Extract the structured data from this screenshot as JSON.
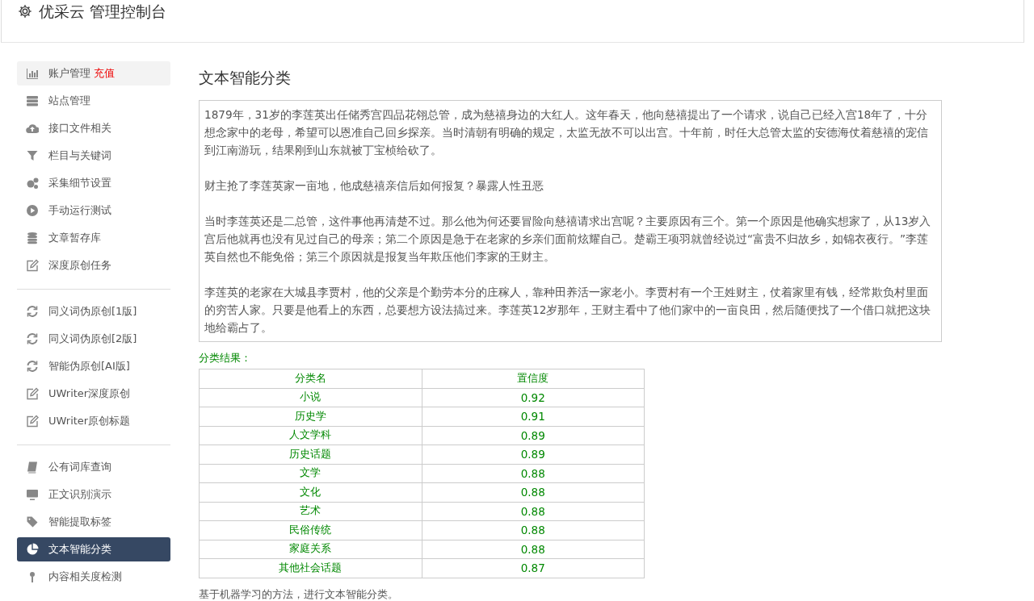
{
  "header": {
    "title": "优采云 管理控制台"
  },
  "sidebar": {
    "groups": [
      {
        "items": [
          {
            "label": "账户管理",
            "badge": "充值",
            "hovered": true,
            "selected": false
          },
          {
            "label": "站点管理",
            "hovered": false,
            "selected": false
          },
          {
            "label": "接口文件相关",
            "hovered": false,
            "selected": false
          },
          {
            "label": "栏目与关键词",
            "hovered": false,
            "selected": false
          },
          {
            "label": "采集细节设置",
            "hovered": false,
            "selected": false
          },
          {
            "label": "手动运行测试",
            "hovered": false,
            "selected": false
          },
          {
            "label": "文章暂存库",
            "hovered": false,
            "selected": false
          },
          {
            "label": "深度原创任务",
            "hovered": false,
            "selected": false
          }
        ]
      },
      {
        "items": [
          {
            "label": "同义词伪原创[1版]",
            "hovered": false,
            "selected": false
          },
          {
            "label": "同义词伪原创[2版]",
            "hovered": false,
            "selected": false
          },
          {
            "label": "智能伪原创[AI版]",
            "hovered": false,
            "selected": false
          },
          {
            "label": "UWriter深度原创",
            "hovered": false,
            "selected": false
          },
          {
            "label": "UWriter原创标题",
            "hovered": false,
            "selected": false
          }
        ]
      },
      {
        "items": [
          {
            "label": "公有词库查询",
            "hovered": false,
            "selected": false
          },
          {
            "label": "正文识别演示",
            "hovered": false,
            "selected": false
          },
          {
            "label": "智能提取标签",
            "hovered": false,
            "selected": false
          },
          {
            "label": "文本智能分类",
            "hovered": false,
            "selected": true
          },
          {
            "label": "内容相关度检测",
            "hovered": false,
            "selected": false
          }
        ]
      }
    ]
  },
  "main": {
    "title": "文本智能分类",
    "input": {
      "paragraphs": [
        "1879年，31岁的李莲英出任储秀宫四品花翎总管，成为慈禧身边的大红人。这年春天，他向慈禧提出了一个请求，说自己已经入宫18年了，十分想念家中的老母，希望可以恩准自己回乡探亲。当时清朝有明确的规定，太监无故不可以出宫。十年前，时任大总管太监的安德海仗着慈禧的宠信到江南游玩，结果刚到山东就被丁宝桢给砍了。",
        "财主抢了李莲英家一亩地，他成慈禧亲信后如何报复？暴露人性丑恶",
        "当时李莲英还是二总管，这件事他再清楚不过。那么他为何还要冒险向慈禧请求出宫呢？主要原因有三个。第一个原因是他确实想家了，从13岁入宫后他就再也没有见过自己的母亲；第二个原因是急于在老家的乡亲们面前炫耀自己。楚霸王项羽就曾经说过“富贵不归故乡，如锦衣夜行。”李莲英自然也不能免俗；第三个原因就是报复当年欺压他们李家的王财主。",
        "李莲英的老家在大城县李贾村，他的父亲是个勤劳本分的庄稼人，靠种田养活一家老小。李贾村有一个王姓财主，仗着家里有钱，经常欺负村里面的穷苦人家。只要是他看上的东西，总要想方设法搞过来。李莲英12岁那年，王财主看中了他们家中的一亩良田，然后随便找了一个借口就把这块地给霸占了。"
      ]
    },
    "result_label": "分类结果：",
    "table": {
      "columns": [
        "分类名",
        "置信度"
      ],
      "rows": [
        [
          "小说",
          "0.92"
        ],
        [
          "历史学",
          "0.91"
        ],
        [
          "人文学科",
          "0.89"
        ],
        [
          "历史话题",
          "0.89"
        ],
        [
          "文学",
          "0.88"
        ],
        [
          "文化",
          "0.88"
        ],
        [
          "艺术",
          "0.88"
        ],
        [
          "民俗传统",
          "0.88"
        ],
        [
          "家庭关系",
          "0.88"
        ],
        [
          "其他社会话题",
          "0.87"
        ]
      ]
    },
    "note": "基于机器学习的方法，进行文本智能分类。"
  }
}
